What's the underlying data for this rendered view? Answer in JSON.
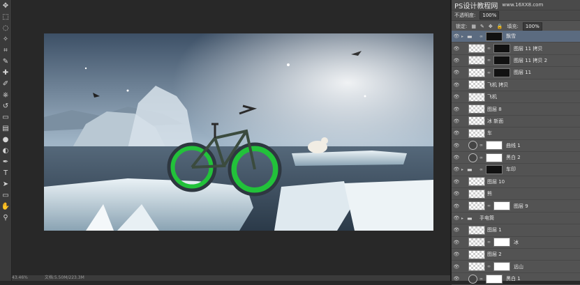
{
  "tools": [
    "move",
    "marquee",
    "lasso",
    "quick-select",
    "crop",
    "eyedropper",
    "healing",
    "brush",
    "clone-stamp",
    "history-brush",
    "eraser",
    "gradient",
    "blur",
    "dodge",
    "pen",
    "type",
    "path-select",
    "shape",
    "hand",
    "zoom"
  ],
  "panel_header": {
    "watermark": "PS设计教程网",
    "watermark_url": "www.16XX8.com",
    "opacity_label": "不透明度:",
    "opacity_value": "100%"
  },
  "lock_row": {
    "lock_label": "锁定:",
    "fill_label": "填充:",
    "fill_value": "100%"
  },
  "layers": [
    {
      "name": "飘雪",
      "type": "group",
      "selected": true,
      "mask": "black"
    },
    {
      "name": "图层 11 拷贝",
      "type": "pixel",
      "mask": "black"
    },
    {
      "name": "图层 11 拷贝 2",
      "type": "pixel",
      "mask": "black"
    },
    {
      "name": "图层 11",
      "type": "pixel",
      "mask": "black"
    },
    {
      "name": "飞机 拷贝",
      "type": "pixel"
    },
    {
      "name": "飞机",
      "type": "pixel"
    },
    {
      "name": "图层 8",
      "type": "pixel"
    },
    {
      "name": "冰 新面",
      "type": "pixel"
    },
    {
      "name": "车",
      "type": "pixel"
    },
    {
      "name": "曲线 1",
      "type": "adjustment",
      "mask": "white"
    },
    {
      "name": "黑白 2",
      "type": "adjustment",
      "mask": "white"
    },
    {
      "name": "车印",
      "type": "group",
      "mask": "black"
    },
    {
      "name": "图层 10",
      "type": "pixel"
    },
    {
      "name": "熊",
      "type": "pixel"
    },
    {
      "name": "图层 9",
      "type": "pixel",
      "mask": "white"
    },
    {
      "name": "手电筒",
      "type": "group"
    },
    {
      "name": "图层 1",
      "type": "pixel"
    },
    {
      "name": "冰",
      "type": "pixel",
      "mask": "white"
    },
    {
      "name": "图层 2",
      "type": "pixel"
    },
    {
      "name": "远山",
      "type": "pixel",
      "mask": "white"
    },
    {
      "name": "黑白 1",
      "type": "adjustment",
      "mask": "white"
    }
  ],
  "status": {
    "zoom": "43.46%",
    "doc_label": "文档:5.50M/223.3M"
  }
}
